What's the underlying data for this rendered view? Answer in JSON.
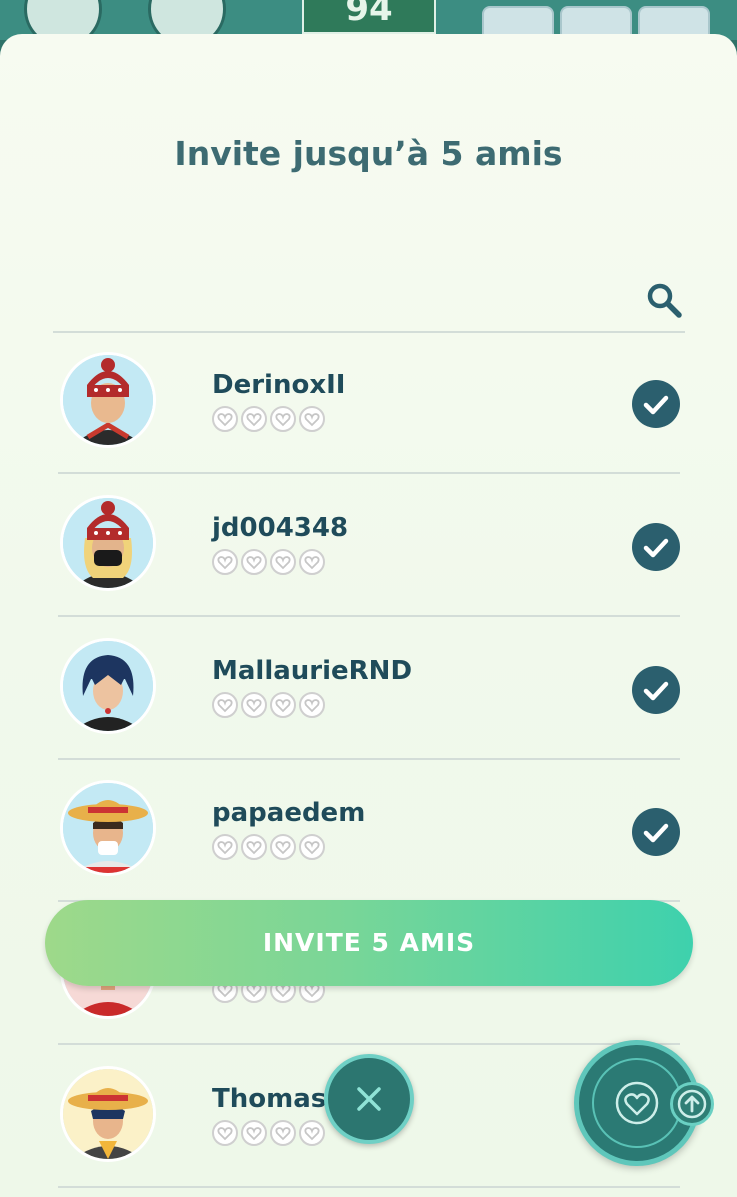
{
  "header": {
    "level_value": "94"
  },
  "dialog": {
    "title": "Invite jusqu’à 5 amis",
    "search_icon": "search-icon"
  },
  "friends": [
    {
      "name": "DerinoxII",
      "hearts_filled": 0,
      "hearts_total": 4,
      "selected": true
    },
    {
      "name": "jd004348",
      "hearts_filled": 0,
      "hearts_total": 4,
      "selected": true
    },
    {
      "name": "MallaurieRND",
      "hearts_filled": 0,
      "hearts_total": 4,
      "selected": true
    },
    {
      "name": "papaedem",
      "hearts_filled": 0,
      "hearts_total": 4,
      "selected": true
    },
    {
      "name": "",
      "hearts_filled": 0,
      "hearts_total": 4,
      "selected": false
    },
    {
      "name": "ThomasN",
      "hearts_filled": 0,
      "hearts_total": 4,
      "selected": false
    }
  ],
  "actions": {
    "invite_label": "INVITE 5 AMIS",
    "close_icon": "close-icon",
    "friends_icon": "heart-icon",
    "badge_icon": "arrow-up-icon"
  },
  "colors": {
    "accent_dark": "#2b5f6e",
    "button_gradient_start": "#9ed98a",
    "button_gradient_end": "#3ed1ad",
    "title": "#3d6b72",
    "name": "#1f4b5a"
  }
}
